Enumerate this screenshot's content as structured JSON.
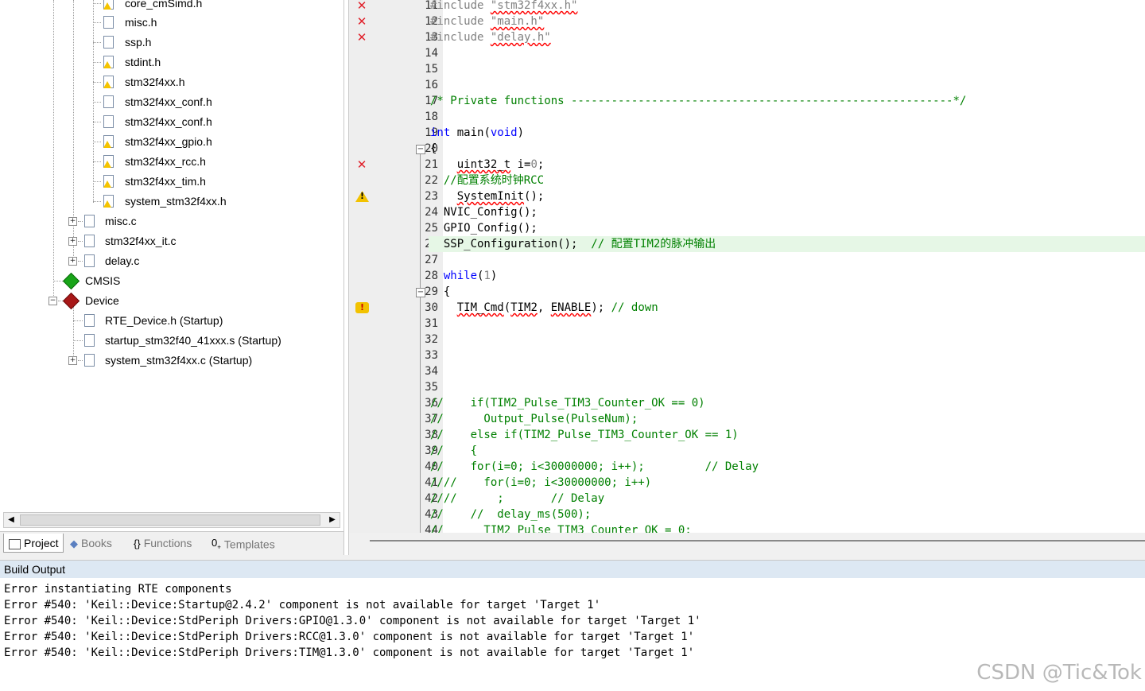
{
  "project_tree": {
    "items": [
      {
        "label": "core_cmSimd.h",
        "icon": "header-file-warning-icon"
      },
      {
        "label": "misc.h",
        "icon": "header-file-icon"
      },
      {
        "label": "ssp.h",
        "icon": "header-file-icon"
      },
      {
        "label": "stdint.h",
        "icon": "header-file-warning-icon"
      },
      {
        "label": "stm32f4xx.h",
        "icon": "header-file-warning-icon"
      },
      {
        "label": "stm32f4xx_conf.h",
        "icon": "header-file-icon"
      },
      {
        "label": "stm32f4xx_conf.h",
        "icon": "header-file-icon"
      },
      {
        "label": "stm32f4xx_gpio.h",
        "icon": "header-file-warning-icon"
      },
      {
        "label": "stm32f4xx_rcc.h",
        "icon": "header-file-warning-icon"
      },
      {
        "label": "stm32f4xx_tim.h",
        "icon": "header-file-warning-icon"
      },
      {
        "label": "system_stm32f4xx.h",
        "icon": "header-file-warning-icon"
      },
      {
        "label": "misc.c",
        "icon": "source-file-icon"
      },
      {
        "label": "stm32f4xx_it.c",
        "icon": "source-file-icon"
      },
      {
        "label": "delay.c",
        "icon": "source-file-icon"
      },
      {
        "label": "CMSIS",
        "icon": "component-green-icon"
      },
      {
        "label": "Device",
        "icon": "component-red-icon"
      },
      {
        "label": "RTE_Device.h (Startup)",
        "icon": "file-icon"
      },
      {
        "label": "startup_stm32f40_41xxx.s (Startup)",
        "icon": "file-icon"
      },
      {
        "label": "system_stm32f4xx.c (Startup)",
        "icon": "file-icon"
      }
    ]
  },
  "panel_tabs": [
    {
      "label": "Project",
      "icon": "project-icon",
      "active": true
    },
    {
      "label": "Books",
      "icon": "books-icon",
      "active": false
    },
    {
      "label": "Functions",
      "icon": "functions-icon",
      "active": false
    },
    {
      "label": "Templates",
      "icon": "templates-icon",
      "active": false
    }
  ],
  "editor": {
    "line_numbers": [
      "11",
      "12",
      "13",
      "14",
      "15",
      "16",
      "17",
      "18",
      "19",
      "20",
      "21",
      "22",
      "23",
      "24",
      "25",
      "26",
      "27",
      "28",
      "29",
      "30",
      "31",
      "32",
      "33",
      "34",
      "35",
      "36",
      "37",
      "38",
      "39",
      "40",
      "41",
      "42",
      "43",
      "44"
    ],
    "markers": {
      "11": "error",
      "12": "error",
      "13": "error",
      "21": "error",
      "23": "warning",
      "30": "warning-alt"
    },
    "code": {
      "l11_kw": "#include ",
      "l11_str": "\"stm32f4xx.h\"",
      "l12_kw": "#include ",
      "l12_str": "\"main.h\"",
      "l13_kw": "#include ",
      "l13_str": "\"delay.h\"",
      "l17": "/* Private functions ---------------------------------------------------------*/",
      "l19_kw": "int",
      "l19_a": " main(",
      "l19_kw2": "void",
      "l19_b": ")",
      "l20": "{",
      "l21_a": "    ",
      "l21_sq": "uint32_t",
      "l21_b": " i=",
      "l21_num": "0",
      "l21_c": ";",
      "l22": "  //配置系统时钟RCC",
      "l23_a": "    ",
      "l23_sq": "SystemInit",
      "l23_b": "();",
      "l24": "  NVIC_Config();",
      "l25": "  GPIO_Config();",
      "l26_a": "  SSP_Configuration();  ",
      "l26_cm": "// 配置TIM2的脉冲输出",
      "l28_a": "  ",
      "l28_kw": "while",
      "l28_b": "(",
      "l28_num": "1",
      "l28_c": ")",
      "l29": "  {",
      "l30_a": "    ",
      "l30_sq1": "TIM_Cmd",
      "l30_b": "(",
      "l30_sq2": "TIM2",
      "l30_c": ", ",
      "l30_sq3": "ENABLE",
      "l30_d": "); ",
      "l30_cm": "// down",
      "l36": "//    if(TIM2_Pulse_TIM3_Counter_OK == 0)",
      "l37": "//      Output_Pulse(PulseNum);",
      "l38": "//    else if(TIM2_Pulse_TIM3_Counter_OK == 1)",
      "l39": "//    {",
      "l40": "//    for(i=0; i<30000000; i++);         // Delay",
      "l41": "////    for(i=0; i<30000000; i++)",
      "l42": "////      ;       // Delay",
      "l43": "//    //  delay_ms(500);",
      "l44": "//      TIM2_Pulse_TIM3_Counter_OK = 0;"
    }
  },
  "build_output": {
    "title": "Build Output",
    "lines": [
      "Error instantiating RTE components",
      "Error #540: 'Keil::Device:Startup@2.4.2' component is not available for target 'Target 1'",
      "Error #540: 'Keil::Device:StdPeriph Drivers:GPIO@1.3.0' component is not available for target 'Target 1'",
      "Error #540: 'Keil::Device:StdPeriph Drivers:RCC@1.3.0' component is not available for target 'Target 1'",
      "Error #540: 'Keil::Device:StdPeriph Drivers:TIM@1.3.0' component is not available for target 'Target 1'"
    ],
    "watermark": "CSDN @Tic&Tok"
  },
  "colors": {
    "error": "#e0202a",
    "warning": "#f2c200",
    "comment": "#008000",
    "keyword": "#0000ff",
    "highlight_line": "#e6f7e6"
  }
}
